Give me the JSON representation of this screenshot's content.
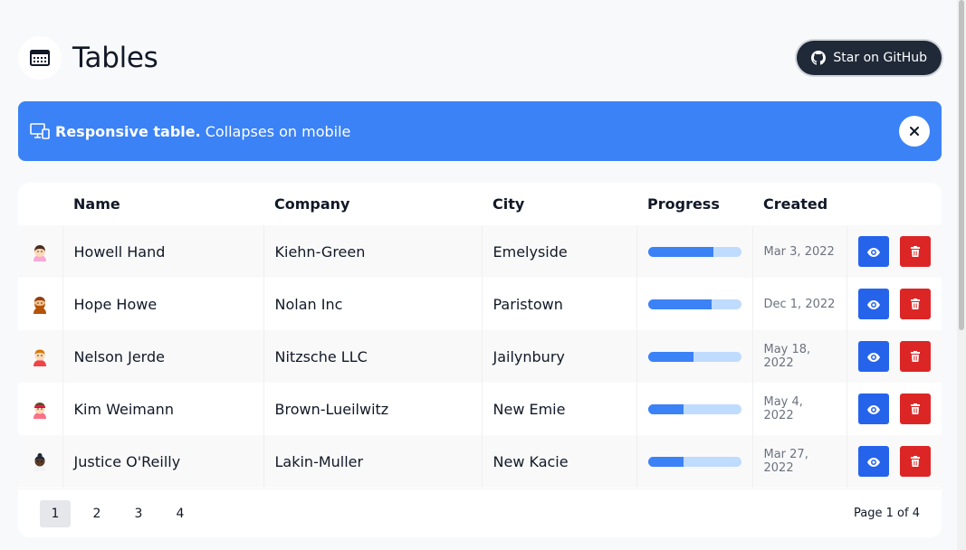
{
  "header": {
    "title": "Tables",
    "icon": "table-icon",
    "github_label": "Star on GitHub",
    "github_icon": "github-icon"
  },
  "banner": {
    "icon": "monitor-responsive-icon",
    "strong": "Responsive table.",
    "text": "Collapses on mobile",
    "close_icon": "close-icon",
    "color": "#3b82f6"
  },
  "table": {
    "columns": [
      "Name",
      "Company",
      "City",
      "Progress",
      "Created"
    ],
    "rows": [
      {
        "name": "Howell Hand",
        "company": "Kiehn-Green",
        "city": "Emelyside",
        "progress": 70,
        "created": "Mar 3, 2022",
        "avatar": "avatar-dark-hair"
      },
      {
        "name": "Hope Howe",
        "company": "Nolan Inc",
        "city": "Paristown",
        "progress": 68,
        "created": "Dec 1, 2022",
        "avatar": "avatar-bearded"
      },
      {
        "name": "Nelson Jerde",
        "company": "Nitzsche LLC",
        "city": "Jailynbury",
        "progress": 49,
        "created": "May 18, 2022",
        "avatar": "avatar-red-shirt"
      },
      {
        "name": "Kim Weimann",
        "company": "Brown-Lueilwitz",
        "city": "New Emie",
        "progress": 38,
        "created": "May 4, 2022",
        "avatar": "avatar-headband"
      },
      {
        "name": "Justice O'Reilly",
        "company": "Lakin-Muller",
        "city": "New Kacie",
        "progress": 38,
        "created": "Mar 27, 2022",
        "avatar": "avatar-dark-skin"
      }
    ],
    "view_icon": "eye-icon",
    "delete_icon": "trash-icon"
  },
  "pagination": {
    "pages": [
      "1",
      "2",
      "3",
      "4"
    ],
    "active": "1",
    "info": "Page 1 of 4"
  },
  "colors": {
    "primary": "#3b82f6",
    "view": "#2563eb",
    "danger": "#dc2626",
    "progress_track": "#bfdbfe"
  }
}
